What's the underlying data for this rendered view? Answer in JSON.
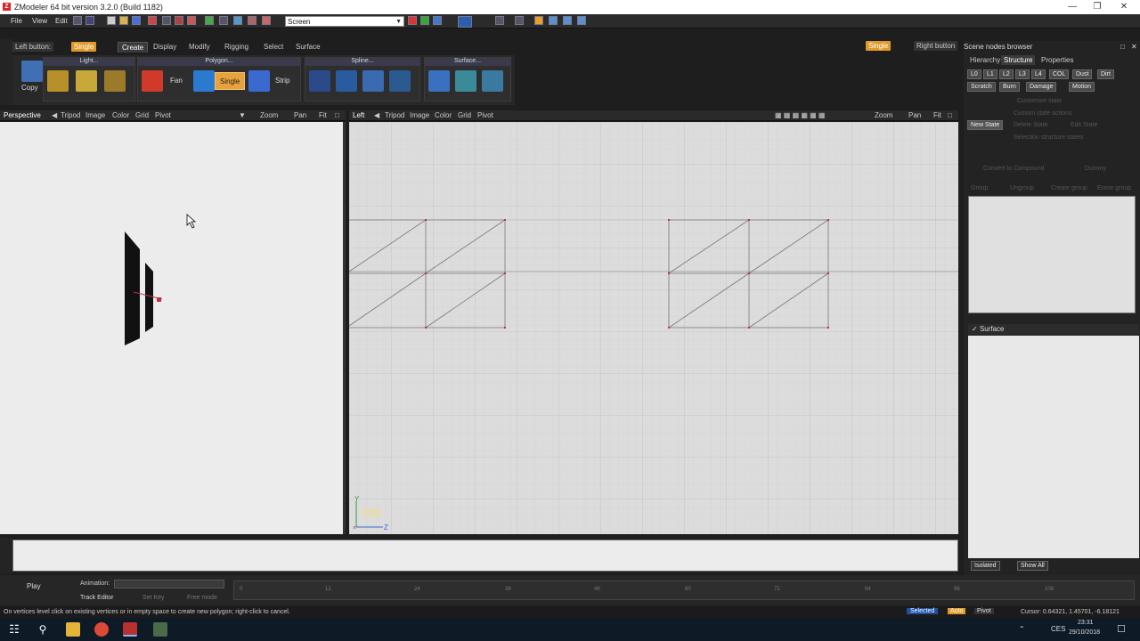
{
  "window": {
    "title": "ZModeler 64 bit version 3.2.0 (Build 1182)",
    "app_icon": "Z"
  },
  "menubar": {
    "items": [
      "File",
      "View",
      "Edit"
    ],
    "screen_select": "Screen"
  },
  "toolbar2": {
    "left_button_label": "Left button:",
    "left_mode": "Single",
    "tabs": [
      "Create",
      "Display",
      "Modify",
      "Rigging",
      "Select",
      "Surface"
    ],
    "right_mode": "Single",
    "right_button_label": "Right button"
  },
  "ribbon": {
    "copy_label": "Copy",
    "groups": {
      "light": "Light...",
      "polygon": "Polygon...",
      "spline": "Spline...",
      "surface": "Surface..."
    },
    "polygon_buttons": [
      "Fan",
      "Single",
      "Strip"
    ]
  },
  "viewport_left": {
    "name": "Perspective",
    "items": [
      "Tripod",
      "Image",
      "Color",
      "Grid",
      "Pivot"
    ],
    "nav": [
      "Zoom",
      "Pan",
      "Fit"
    ]
  },
  "viewport_right": {
    "name": "Left",
    "items": [
      "Tripod",
      "Image",
      "Color",
      "Grid",
      "Pivot"
    ],
    "nav": [
      "Zoom",
      "Pan",
      "Fit"
    ],
    "axis_y": "Y",
    "axis_z": "Z"
  },
  "panel": {
    "title": "Scene nodes browser",
    "tabs": [
      "Hierarchy",
      "Structure",
      "Properties"
    ],
    "lod_buttons": [
      "L0",
      "L1",
      "L2",
      "L3",
      "L4",
      "COL",
      "Dust",
      "Dirt"
    ],
    "row2": [
      "Scratch",
      "Burn",
      "Damage",
      "Motion"
    ],
    "dim_texts": [
      "Customize state",
      "Custom state actions",
      "Selection structure states"
    ],
    "new_state": "New State",
    "delete_state": "Delete State",
    "edit_state": "Edit State",
    "convert": "Convert to Compound",
    "dummy": "Dummy",
    "row_group": [
      "Group",
      "Ungroup",
      "Create group",
      "Erase group"
    ],
    "surface_label": "Surface",
    "bottom": {
      "isolated": "Isolated",
      "show_all": "Show All"
    }
  },
  "timeline": {
    "play": "Play",
    "animation_label": "Animation:",
    "track_editor": "Track Editor",
    "set_key": "Set Key",
    "free_mode": "Free mode",
    "ticks": [
      "0",
      "12",
      "24",
      "36",
      "48",
      "60",
      "72",
      "84",
      "96",
      "108"
    ]
  },
  "statusbar": {
    "hint": "On vertices level click on existing vertices or in empty space to create new polygon; right-click to cancel.",
    "selected": "Selected",
    "auto": "Auto",
    "pivot": "Pivot",
    "cursor": "Cursor: 0.64321, 1.45701, -6.18121"
  },
  "taskbar": {
    "lang": "CES",
    "time": "23:31",
    "date": "29/10/2018"
  },
  "colors": {
    "accent_orange": "#e19a2a",
    "grid_bg": "#dcdcdc",
    "vertex_red": "#c0304a"
  }
}
